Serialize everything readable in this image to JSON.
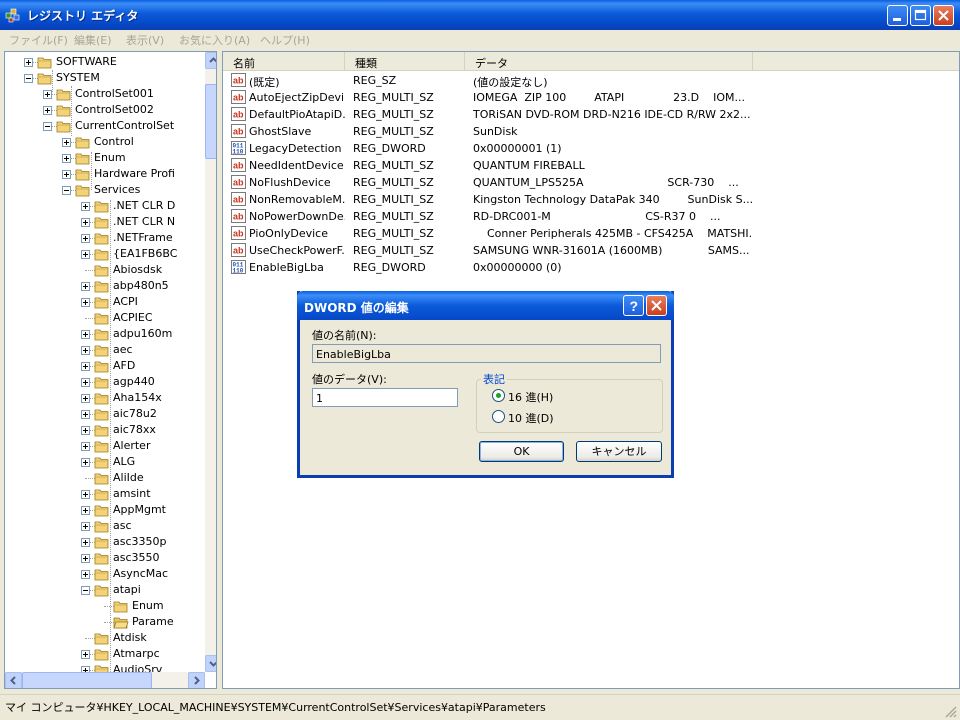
{
  "window": {
    "title": "レジストリ エディタ"
  },
  "menu": [
    "ファイル(F)",
    "編集(E)",
    "表示(V)",
    "お気に入り(A)",
    "ヘルプ(H)"
  ],
  "tree": [
    {
      "label": "SOFTWARE",
      "level": 2,
      "exp": "plus"
    },
    {
      "label": "SYSTEM",
      "level": 2,
      "exp": "minus"
    },
    {
      "label": "ControlSet001",
      "level": 3,
      "exp": "plus"
    },
    {
      "label": "ControlSet002",
      "level": 3,
      "exp": "plus"
    },
    {
      "label": "CurrentControlSet",
      "level": 3,
      "exp": "minus"
    },
    {
      "label": "Control",
      "level": 4,
      "exp": "plus"
    },
    {
      "label": "Enum",
      "level": 4,
      "exp": "plus"
    },
    {
      "label": "Hardware Profi",
      "level": 4,
      "exp": "plus"
    },
    {
      "label": "Services",
      "level": 4,
      "exp": "minus"
    },
    {
      "label": ".NET CLR D",
      "level": 5,
      "exp": "plus"
    },
    {
      "label": ".NET CLR N",
      "level": 5,
      "exp": "plus"
    },
    {
      "label": ".NETFrame",
      "level": 5,
      "exp": "plus"
    },
    {
      "label": "{EA1FB6BC",
      "level": 5,
      "exp": "plus"
    },
    {
      "label": "Abiosdsk",
      "level": 5,
      "exp": ""
    },
    {
      "label": "abp480n5",
      "level": 5,
      "exp": "plus"
    },
    {
      "label": "ACPI",
      "level": 5,
      "exp": "plus"
    },
    {
      "label": "ACPIEC",
      "level": 5,
      "exp": ""
    },
    {
      "label": "adpu160m",
      "level": 5,
      "exp": "plus"
    },
    {
      "label": "aec",
      "level": 5,
      "exp": "plus"
    },
    {
      "label": "AFD",
      "level": 5,
      "exp": "plus"
    },
    {
      "label": "agp440",
      "level": 5,
      "exp": "plus"
    },
    {
      "label": "Aha154x",
      "level": 5,
      "exp": "plus"
    },
    {
      "label": "aic78u2",
      "level": 5,
      "exp": "plus"
    },
    {
      "label": "aic78xx",
      "level": 5,
      "exp": "plus"
    },
    {
      "label": "Alerter",
      "level": 5,
      "exp": "plus"
    },
    {
      "label": "ALG",
      "level": 5,
      "exp": "plus"
    },
    {
      "label": "AliIde",
      "level": 5,
      "exp": ""
    },
    {
      "label": "amsint",
      "level": 5,
      "exp": "plus"
    },
    {
      "label": "AppMgmt",
      "level": 5,
      "exp": "plus"
    },
    {
      "label": "asc",
      "level": 5,
      "exp": "plus"
    },
    {
      "label": "asc3350p",
      "level": 5,
      "exp": "plus"
    },
    {
      "label": "asc3550",
      "level": 5,
      "exp": "plus"
    },
    {
      "label": "AsyncMac",
      "level": 5,
      "exp": "plus"
    },
    {
      "label": "atapi",
      "level": 5,
      "exp": "minus"
    },
    {
      "label": "Enum",
      "level": 6,
      "exp": ""
    },
    {
      "label": "Parame",
      "level": 6,
      "exp": "",
      "open": true
    },
    {
      "label": "Atdisk",
      "level": 5,
      "exp": ""
    },
    {
      "label": "Atmarpc",
      "level": 5,
      "exp": "plus"
    },
    {
      "label": "AudioSrv",
      "level": 5,
      "exp": "plus"
    }
  ],
  "list": {
    "columns": [
      "名前",
      "種類",
      "データ"
    ],
    "rows": [
      {
        "icon": "ab",
        "name": "(既定)",
        "type": "REG_SZ",
        "data": "(値の設定なし)"
      },
      {
        "icon": "ab",
        "name": "AutoEjectZipDevi...",
        "type": "REG_MULTI_SZ",
        "data": "IOMEGA  ZIP 100        ATAPI              23.D    IOM..."
      },
      {
        "icon": "ab",
        "name": "DefaultPioAtapiD...",
        "type": "REG_MULTI_SZ",
        "data": "TORiSAN DVD-ROM DRD-N216 IDE-CD R/RW 2x2..."
      },
      {
        "icon": "ab",
        "name": "GhostSlave",
        "type": "REG_MULTI_SZ",
        "data": "SunDisk"
      },
      {
        "icon": "bin",
        "name": "LegacyDetection",
        "type": "REG_DWORD",
        "data": "0x00000001 (1)"
      },
      {
        "icon": "ab",
        "name": "NeedIdentDevice",
        "type": "REG_MULTI_SZ",
        "data": "QUANTUM FIREBALL"
      },
      {
        "icon": "ab",
        "name": "NoFlushDevice",
        "type": "REG_MULTI_SZ",
        "data": "QUANTUM_LPS525A                        SCR-730    ..."
      },
      {
        "icon": "ab",
        "name": "NonRemovableM...",
        "type": "REG_MULTI_SZ",
        "data": "Kingston Technology DataPak 340        SunDisk S..."
      },
      {
        "icon": "ab",
        "name": "NoPowerDownDe...",
        "type": "REG_MULTI_SZ",
        "data": "RD-DRC001-M                           CS-R37 0    ..."
      },
      {
        "icon": "ab",
        "name": "PioOnlyDevice",
        "type": "REG_MULTI_SZ",
        "data": "    Conner Peripherals 425MB - CFS425A    MATSHI..."
      },
      {
        "icon": "ab",
        "name": "UseCheckPowerF...",
        "type": "REG_MULTI_SZ",
        "data": "SAMSUNG WNR-31601A (1600MB)             SAMS..."
      },
      {
        "icon": "bin",
        "name": "EnableBigLba",
        "type": "REG_DWORD",
        "data": "0x00000000 (0)"
      }
    ]
  },
  "status": {
    "path": "マイ コンピュータ¥HKEY_LOCAL_MACHINE¥SYSTEM¥CurrentControlSet¥Services¥atapi¥Parameters"
  },
  "dialog": {
    "title": "DWORD 値の編集",
    "name_label": "値の名前(N):",
    "name_value": "EnableBigLba",
    "data_label": "値のデータ(V):",
    "data_value": "1",
    "group_label": "表記",
    "radio_hex": "16 進(H)",
    "radio_dec": "10 進(D)",
    "selected": "hex",
    "ok": "OK",
    "cancel": "キャンセル"
  },
  "colors": {
    "titlebar": "#0a5fe0",
    "dialog_close": "#d8542f",
    "selection": "#316ac5"
  }
}
